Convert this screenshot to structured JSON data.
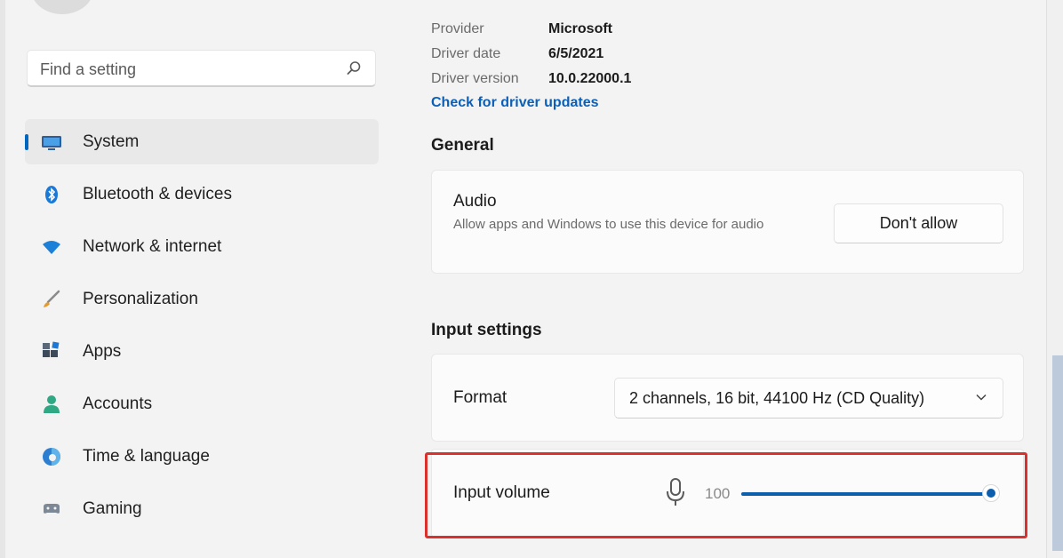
{
  "search": {
    "placeholder": "Find a setting"
  },
  "sidebar": {
    "items": [
      {
        "label": "System",
        "icon": "monitor-icon",
        "active": true
      },
      {
        "label": "Bluetooth & devices",
        "icon": "bluetooth-icon"
      },
      {
        "label": "Network & internet",
        "icon": "wifi-icon"
      },
      {
        "label": "Personalization",
        "icon": "brush-icon"
      },
      {
        "label": "Apps",
        "icon": "apps-icon"
      },
      {
        "label": "Accounts",
        "icon": "person-icon"
      },
      {
        "label": "Time & language",
        "icon": "globe-clock-icon"
      },
      {
        "label": "Gaming",
        "icon": "gamepad-icon"
      }
    ]
  },
  "driver": {
    "provider_label": "Provider",
    "provider_value": "Microsoft",
    "date_label": "Driver date",
    "date_value": "6/5/2021",
    "version_label": "Driver version",
    "version_value": "10.0.22000.1",
    "check_link": "Check for driver updates"
  },
  "general": {
    "title": "General",
    "audio_title": "Audio",
    "audio_desc": "Allow apps and Windows to use this device for audio",
    "audio_button": "Don't allow"
  },
  "input_settings": {
    "title": "Input settings",
    "format_label": "Format",
    "format_value": "2 channels, 16 bit, 44100 Hz (CD Quality)",
    "volume_label": "Input volume",
    "volume_value": "100",
    "volume_level": 1.0
  },
  "colors": {
    "accent": "#0067c0",
    "slider": "#0d5fae",
    "highlight": "#d9312e",
    "link": "#0a5fb8"
  }
}
